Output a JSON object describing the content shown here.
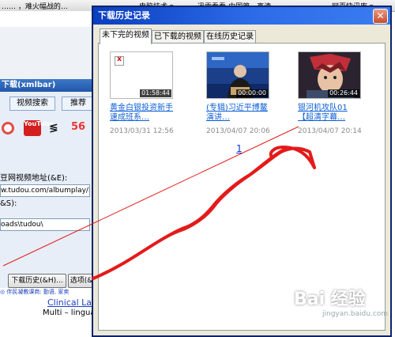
{
  "browser": {
    "top_items": [
      "…… ，难火幅战的…",
      "电脑技术 ▾",
      "迅雷看看-中国第一高清…",
      "网页快讯库 ▾"
    ],
    "left_app": {
      "title": "下载(xmlbar)",
      "tabs": [
        "视频搜索",
        "推荐"
      ],
      "sites": [
        "YouTube",
        "56"
      ],
      "address_label": "豆网视频地址(&E):",
      "address_value": "w.tudou.com/albumplay/RY",
      "save_label": "&S):",
      "save_value": "oads\\tudou\\",
      "buttons": [
        "下载历史(&H)...",
        "选项(&"
      ],
      "banner": "◎ 伴民凝教课商: 勤语, 家卖",
      "ad_title": "Clinical La",
      "ad_subtitle": "Multi – lingua"
    }
  },
  "dialog": {
    "title": "下载历史记录",
    "tabs": [
      "未下完的视频",
      "已下载的视频",
      "在线历史记录"
    ],
    "active_tab": 0,
    "videos": [
      {
        "title": "黄金白银投资新手速成班系…",
        "date": "2013/03/31 12:56",
        "duration": "01:58:44",
        "thumb": "broken-image"
      },
      {
        "title": "(专辑)习近平博鳌演讲…",
        "date": "2013/04/07 20:06",
        "duration": "00:00:00",
        "thumb": "news"
      },
      {
        "title": "银河机攻队01【超清字幕…",
        "date": "2013/04/07 20:14",
        "duration": "00:26:44",
        "thumb": "anime"
      }
    ],
    "page": "1"
  },
  "watermark": {
    "brand": "Bai 经验",
    "url": "jingyan.baidu.com"
  },
  "colors": {
    "titlebar": "#0a3fbf",
    "link": "#0b5ed7",
    "annotation": "#e31b1b"
  }
}
